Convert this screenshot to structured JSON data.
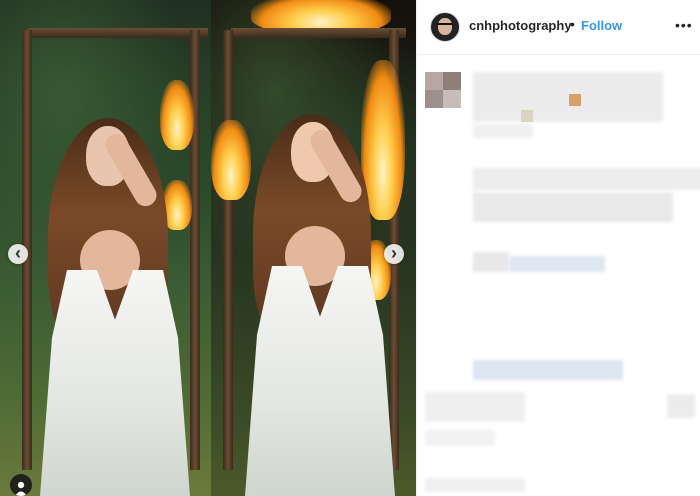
{
  "post": {
    "username": "cnhphotography",
    "separator": "•",
    "follow_label": "Follow",
    "more_glyph": "•••"
  },
  "carousel": {
    "prev_glyph": "‹",
    "next_glyph": "›"
  },
  "colors": {
    "link_blue": "#3897f0",
    "text_dark": "#262626",
    "blur_gray": "#ececec"
  },
  "icons": [
    "user-tag-icon",
    "chevron-left-icon",
    "chevron-right-icon",
    "more-options-icon"
  ]
}
